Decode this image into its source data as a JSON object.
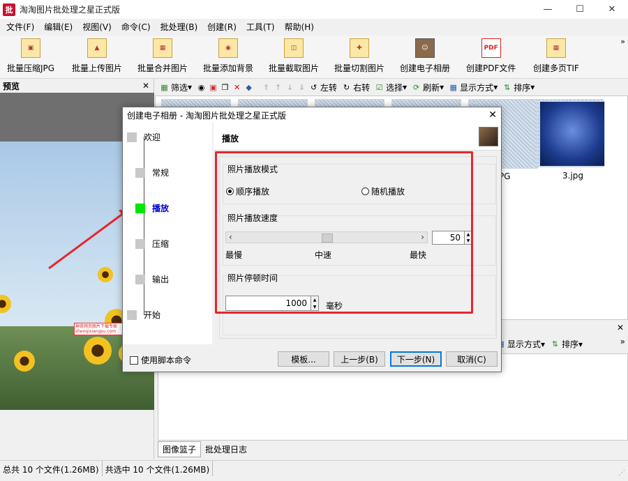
{
  "app": {
    "title": "淘淘图片批处理之星正式版",
    "icon_text": "批"
  },
  "menu": [
    "文件(F)",
    "编辑(E)",
    "视图(V)",
    "命令(C)",
    "批处理(B)",
    "创建(R)",
    "工具(T)",
    "帮助(H)"
  ],
  "big_toolbar": [
    {
      "label": "批量压缩JPG",
      "icon": "compress-jpg-icon"
    },
    {
      "label": "批量上传图片",
      "icon": "upload-icon"
    },
    {
      "label": "批量合并图片",
      "icon": "merge-icon"
    },
    {
      "label": "批量添加背景",
      "icon": "background-icon"
    },
    {
      "label": "批量截取图片",
      "icon": "crop-icon"
    },
    {
      "label": "批量切割图片",
      "icon": "split-icon"
    },
    {
      "label": "创建电子相册",
      "icon": "album-icon"
    },
    {
      "label": "创建PDF文件",
      "icon": "pdf-icon",
      "icon_text": "PDF"
    },
    {
      "label": "创建多页TIF",
      "icon": "tif-icon"
    }
  ],
  "preview": {
    "title": "预览",
    "watermark": "神奇网页图片下载专家 shenqixiangsu.com"
  },
  "sub_toolbar": {
    "filter": "筛选",
    "rotate_left": "左转",
    "rotate_right": "右转",
    "select": "选择",
    "refresh": "刷新",
    "display": "显示方式",
    "sort": "排序"
  },
  "thumbs": {
    "caption_partial": "PG",
    "caption_last": "3.jpg"
  },
  "lower_toolbar": {
    "display": "显示方式",
    "sort": "排序"
  },
  "bottom_tabs": [
    "图像篮子",
    "批处理日志"
  ],
  "status": {
    "total": "总共 10 个文件(1.26MB)",
    "selected": "共选中 10 个文件(1.26MB)"
  },
  "dialog": {
    "title": "创建电子相册 - 淘淘图片批处理之星正式版",
    "nav": [
      "欢迎",
      "常规",
      "播放",
      "压缩",
      "输出",
      "开始"
    ],
    "active_nav": "播放",
    "page_title": "播放",
    "mode_group": "照片播放模式",
    "mode_options": [
      "顺序播放",
      "随机播放"
    ],
    "mode_selected": "顺序播放",
    "speed_group": "照片播放速度",
    "speed_value": "50",
    "speed_fraction": 0.5,
    "speed_labels": [
      "最慢",
      "中速",
      "最快"
    ],
    "pause_group": "照片停顿时间",
    "pause_value": "1000",
    "pause_unit": "毫秒",
    "script_checkbox": "使用脚本命令",
    "buttons": {
      "template": "模板...",
      "prev": "上一步(B)",
      "next": "下一步(N)",
      "cancel": "取消(C)"
    }
  }
}
